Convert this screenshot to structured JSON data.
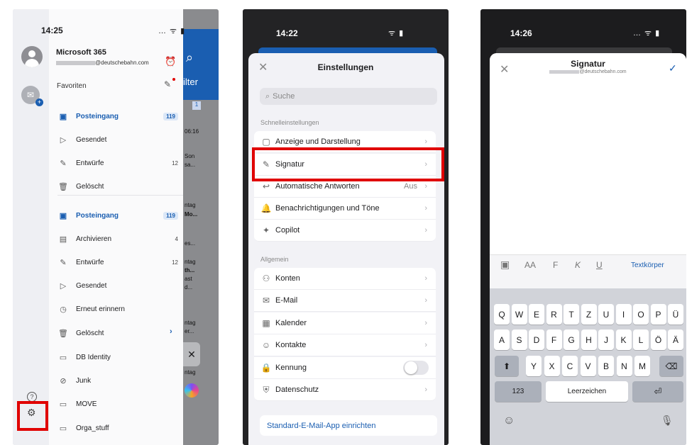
{
  "panel1": {
    "time": "14:25",
    "status_icons": "… ᯤ ▮",
    "account_name": "Microsoft 365",
    "account_email": "@deutschebahn.com",
    "favorites_label": "Favoriten",
    "folders": [
      {
        "label": "Posteingang",
        "count": "119",
        "icon": "inbox-icon",
        "active": true
      },
      {
        "label": "Gesendet",
        "count": "",
        "icon": "send-icon"
      },
      {
        "label": "Entwürfe",
        "count": "12",
        "icon": "draft-icon"
      },
      {
        "label": "Gelöscht",
        "count": "",
        "icon": "trash-icon"
      },
      {
        "label": "Posteingang",
        "count": "119",
        "icon": "inbox-icon",
        "active": true
      },
      {
        "label": "Archivieren",
        "count": "4",
        "icon": "archive-icon"
      },
      {
        "label": "Entwürfe",
        "count": "12",
        "icon": "draft-icon"
      },
      {
        "label": "Gesendet",
        "count": "",
        "icon": "send-icon"
      },
      {
        "label": "Erneut erinnern",
        "count": "",
        "icon": "clock-icon"
      },
      {
        "label": "Gelöscht",
        "count": "",
        "icon": "trash-icon"
      },
      {
        "label": "DB Identity",
        "count": "",
        "icon": "folder-icon"
      },
      {
        "label": "Junk",
        "count": "",
        "icon": "junk-icon"
      },
      {
        "label": "MOVE",
        "count": "",
        "icon": "folder-icon"
      },
      {
        "label": "Orga_stuff",
        "count": "",
        "icon": "folder-icon"
      }
    ],
    "behind": {
      "filter": "ilter",
      "count": "1",
      "t1": "06:16",
      "t2": "Son",
      "t3": "sa...",
      "t4": "ntag",
      "t5": "Mo...",
      "t6": "es...",
      "t7": "ntag",
      "t8": "th...",
      "t9": "ast",
      "t10": "d...",
      "t11": "ntag",
      "t12": "er...",
      "t13": "ntag",
      "close": "✕"
    }
  },
  "panel2": {
    "time": "14:22",
    "status_icons": "ᯤ ▮",
    "close": "✕",
    "title": "Einstellungen",
    "search_placeholder": "Suche",
    "section_quick": "Schnelleinstellungen",
    "quick_items": [
      {
        "label": "Anzeige und Darstellung",
        "icon": "display-icon",
        "value": ""
      },
      {
        "label": "Signatur",
        "icon": "pen-icon",
        "value": ""
      },
      {
        "label": "Automatische Antworten",
        "icon": "auto-reply-icon",
        "value": "Aus"
      },
      {
        "label": "Benachrichtigungen und Töne",
        "icon": "bell-icon",
        "value": ""
      },
      {
        "label": "Copilot",
        "icon": "copilot-icon",
        "value": ""
      }
    ],
    "section_general": "Allgemein",
    "general_items": [
      {
        "label": "Konten",
        "icon": "accounts-icon"
      },
      {
        "label": "E-Mail",
        "icon": "mail-icon"
      },
      {
        "label": "Kalender",
        "icon": "calendar-icon"
      },
      {
        "label": "Kontakte",
        "icon": "contacts-icon"
      },
      {
        "label": "Kennung",
        "icon": "lock-icon"
      },
      {
        "label": "Datenschutz",
        "icon": "privacy-icon"
      }
    ],
    "default_app": "Standard-E-Mail-App einrichten"
  },
  "panel3": {
    "time": "14:26",
    "status_icons": "… ᯤ ▮",
    "close": "✕",
    "title": "Signatur",
    "email": "@deutschebahn.com",
    "confirm": "✓",
    "format_bold": "F",
    "format_italic": "K",
    "format_underline": "U",
    "text_style": "Textkörper",
    "row1": [
      "Q",
      "W",
      "E",
      "R",
      "T",
      "Z",
      "U",
      "I",
      "O",
      "P",
      "Ü"
    ],
    "row2": [
      "A",
      "S",
      "D",
      "F",
      "G",
      "H",
      "J",
      "K",
      "L",
      "Ö",
      "Ä"
    ],
    "row3": [
      "Y",
      "X",
      "C",
      "V",
      "B",
      "N",
      "M"
    ],
    "key_123": "123",
    "key_space": "Leerzeichen",
    "key_return": "⏎",
    "key_shift": "⬆",
    "key_delete": "⌫"
  },
  "colors": {
    "accent_blue": "#1a5eb1",
    "highlight_red": "#e00000"
  }
}
